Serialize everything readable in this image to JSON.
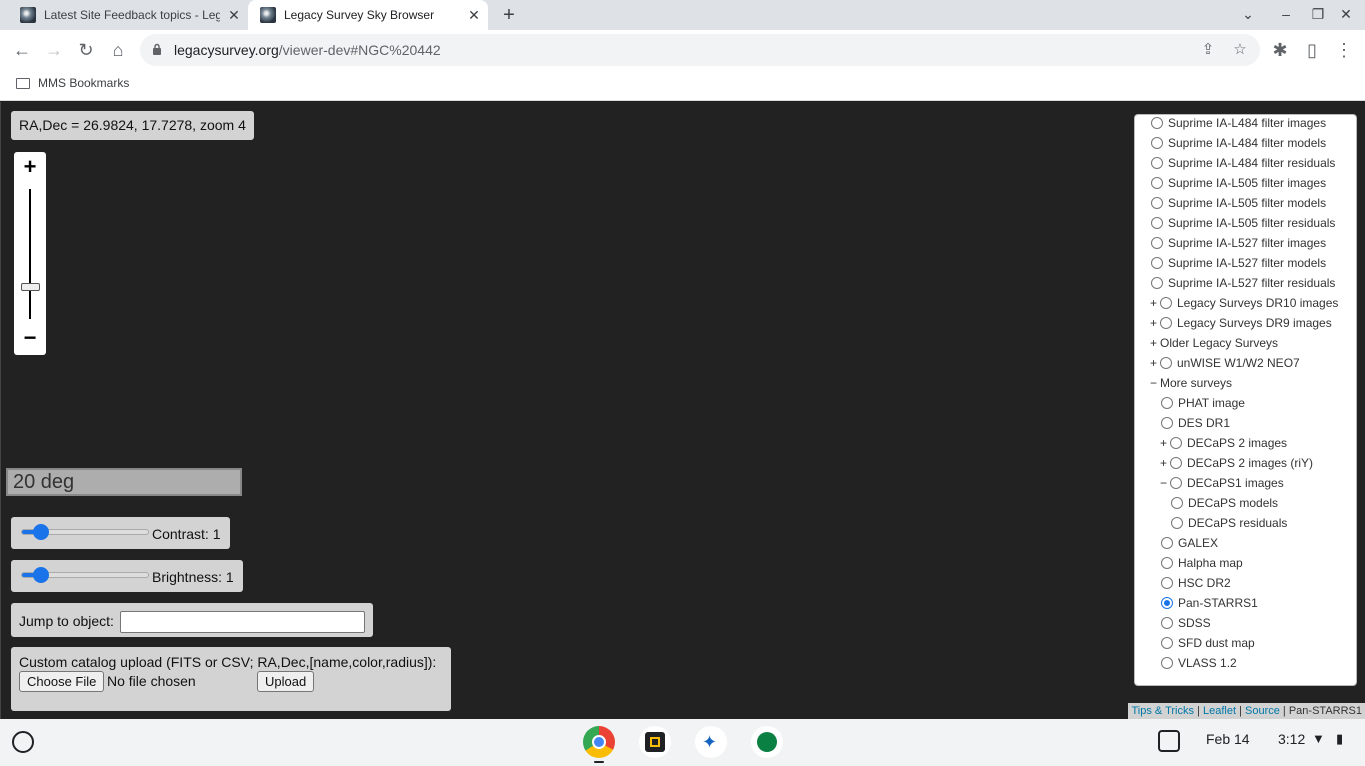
{
  "browser": {
    "tabs": [
      {
        "title": "Latest Site Feedback topics - Leg"
      },
      {
        "title": "Legacy Survey Sky Browser"
      }
    ],
    "url_host": "legacysurvey.org",
    "url_path": "/viewer-dev#NGC%20442",
    "bookmark": "MMS Bookmarks"
  },
  "map": {
    "coords": "RA,Dec = 26.9824, 17.7278, zoom 4",
    "zoom_in": "+",
    "zoom_out": "−",
    "scale": "20 deg",
    "zoom_level_fraction": 0.25,
    "contrast": {
      "label": "Contrast: 1",
      "value": 0.1
    },
    "brightness": {
      "label": "Brightness: 1",
      "value": 0.1
    },
    "jump_label": "Jump to object:",
    "upload_label": "Custom catalog upload (FITS or CSV; RA,Dec,[name,color,radius]):",
    "choose_file": "Choose File",
    "no_file": "No file chosen",
    "upload_button": "Upload"
  },
  "layers": [
    {
      "toggle": "",
      "radio": true,
      "checked": false,
      "indent": 0,
      "label": "Suprime IA-L484 filter images"
    },
    {
      "toggle": "",
      "radio": true,
      "checked": false,
      "indent": 0,
      "label": "Suprime IA-L484 filter models"
    },
    {
      "toggle": "",
      "radio": true,
      "checked": false,
      "indent": 0,
      "label": "Suprime IA-L484 filter residuals"
    },
    {
      "toggle": "",
      "radio": true,
      "checked": false,
      "indent": 0,
      "label": "Suprime IA-L505 filter images"
    },
    {
      "toggle": "",
      "radio": true,
      "checked": false,
      "indent": 0,
      "label": "Suprime IA-L505 filter models"
    },
    {
      "toggle": "",
      "radio": true,
      "checked": false,
      "indent": 0,
      "label": "Suprime IA-L505 filter residuals"
    },
    {
      "toggle": "",
      "radio": true,
      "checked": false,
      "indent": 0,
      "label": "Suprime IA-L527 filter images"
    },
    {
      "toggle": "",
      "radio": true,
      "checked": false,
      "indent": 0,
      "label": "Suprime IA-L527 filter models"
    },
    {
      "toggle": "",
      "radio": true,
      "checked": false,
      "indent": 0,
      "label": "Suprime IA-L527 filter residuals"
    },
    {
      "toggle": "+",
      "radio": true,
      "checked": false,
      "indent": 0,
      "label": "Legacy Surveys DR10 images"
    },
    {
      "toggle": "+",
      "radio": true,
      "checked": false,
      "indent": 0,
      "label": "Legacy Surveys DR9 images"
    },
    {
      "toggle": "+",
      "radio": false,
      "checked": false,
      "indent": 0,
      "label": "Older Legacy Surveys"
    },
    {
      "toggle": "+",
      "radio": true,
      "checked": false,
      "indent": 0,
      "label": "unWISE W1/W2 NEO7"
    },
    {
      "toggle": "−",
      "radio": false,
      "checked": false,
      "indent": 0,
      "label": "More surveys"
    },
    {
      "toggle": "",
      "radio": true,
      "checked": false,
      "indent": 1,
      "label": "PHAT image"
    },
    {
      "toggle": "",
      "radio": true,
      "checked": false,
      "indent": 1,
      "label": "DES DR1"
    },
    {
      "toggle": "+",
      "radio": true,
      "checked": false,
      "indent": 1,
      "label": "DECaPS 2 images"
    },
    {
      "toggle": "+",
      "radio": true,
      "checked": false,
      "indent": 1,
      "label": "DECaPS 2 images (riY)"
    },
    {
      "toggle": "−",
      "radio": true,
      "checked": false,
      "indent": 1,
      "label": "DECaPS1 images"
    },
    {
      "toggle": "",
      "radio": true,
      "checked": false,
      "indent": 2,
      "label": "DECaPS models"
    },
    {
      "toggle": "",
      "radio": true,
      "checked": false,
      "indent": 2,
      "label": "DECaPS residuals"
    },
    {
      "toggle": "",
      "radio": true,
      "checked": false,
      "indent": 1,
      "label": "GALEX"
    },
    {
      "toggle": "",
      "radio": true,
      "checked": false,
      "indent": 1,
      "label": "Halpha map"
    },
    {
      "toggle": "",
      "radio": true,
      "checked": false,
      "indent": 1,
      "label": "HSC DR2"
    },
    {
      "toggle": "",
      "radio": true,
      "checked": true,
      "indent": 1,
      "label": "Pan-STARRS1"
    },
    {
      "toggle": "",
      "radio": true,
      "checked": false,
      "indent": 1,
      "label": "SDSS"
    },
    {
      "toggle": "",
      "radio": true,
      "checked": false,
      "indent": 1,
      "label": "SFD dust map"
    },
    {
      "toggle": "",
      "radio": true,
      "checked": false,
      "indent": 1,
      "label": "VLASS 1.2"
    }
  ],
  "attribution": {
    "tips": "Tips & Tricks",
    "sep1": " | ",
    "leaflet": "Leaflet",
    "sep2": " | ",
    "source": "Source",
    "sep3": " | ",
    "layer": "Pan-STARRS1"
  },
  "shelf": {
    "date": "Feb 14",
    "time": "3:12"
  }
}
